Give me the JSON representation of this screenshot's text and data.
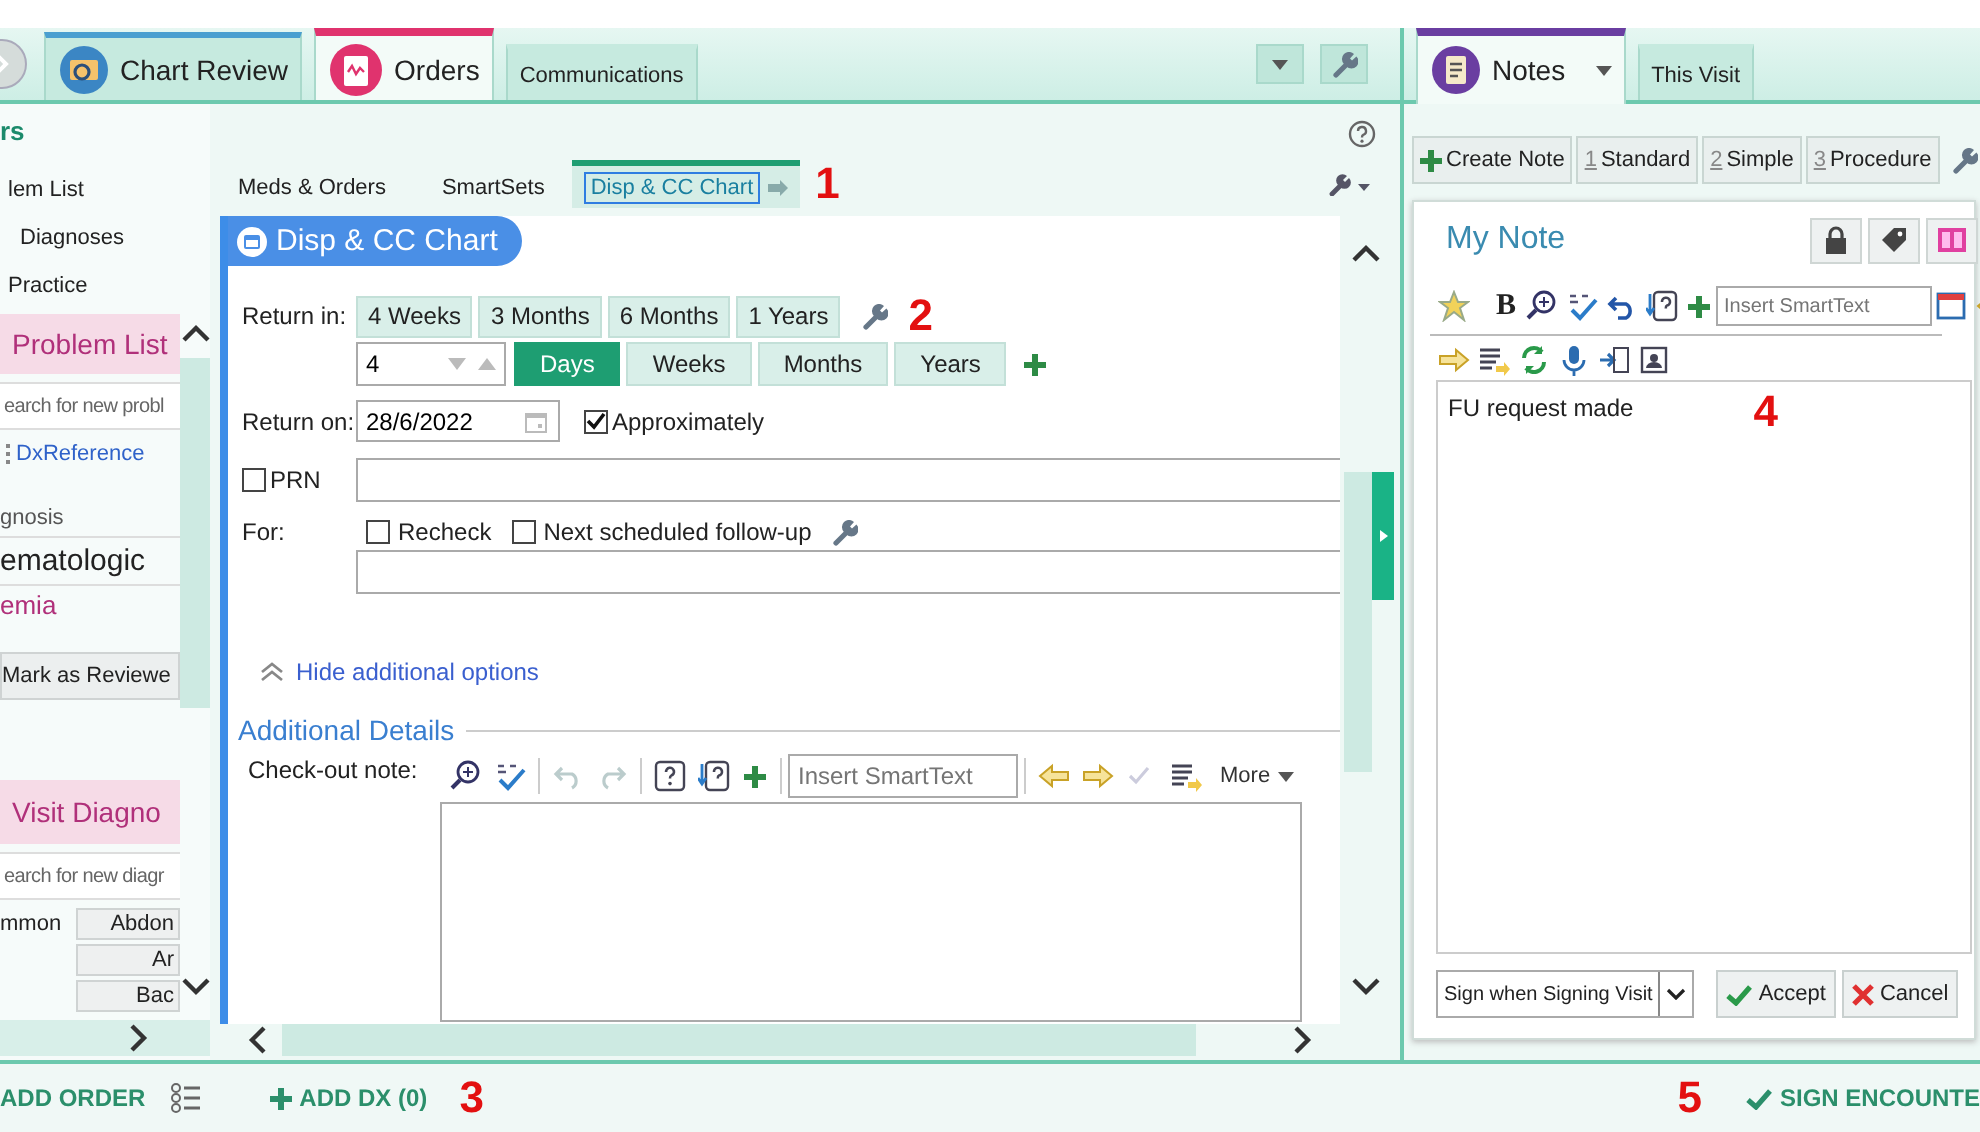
{
  "top_tabs": [
    {
      "label": "Chart Review",
      "selected": false,
      "color": "#4a9fd0"
    },
    {
      "label": "Orders",
      "selected": true,
      "color": "#e0336e"
    },
    {
      "label": "Communications",
      "selected": false
    }
  ],
  "notes_tabs": [
    {
      "label": "Notes",
      "selected": true,
      "color": "#6a3ea1"
    },
    {
      "label": "This Visit",
      "selected": false
    }
  ],
  "sidebar": {
    "header": "rs",
    "items": [
      {
        "label": "lem List"
      },
      {
        "label": "Diagnoses"
      },
      {
        "label": "Practice"
      }
    ],
    "problem_list": {
      "title": "Problem List",
      "search_placeholder": "earch for new probl",
      "link": "DxReference",
      "column_header": "gnosis",
      "group": "ematologic",
      "problem": "emia",
      "review_button": "Mark as Reviewe"
    },
    "visit_diagnoses": {
      "title": "Visit Diagno",
      "search_placeholder": "earch for new diagr",
      "label": "mmon",
      "buttons": [
        "Abdon",
        "Ar",
        "Bac"
      ]
    }
  },
  "activity_tabs": {
    "tabs": [
      {
        "label": "Meds & Orders",
        "selected": false
      },
      {
        "label": "SmartSets",
        "selected": false
      },
      {
        "label": "Disp & CC Chart",
        "selected": true
      }
    ],
    "annotation": "1"
  },
  "form": {
    "title": "Disp & CC Chart",
    "return_in": {
      "label": "Return in:",
      "presets": [
        "4 Weeks",
        "3 Months",
        "6 Months",
        "1 Years"
      ],
      "annotation": "2",
      "amount": "4",
      "units": [
        {
          "label": "Days",
          "selected": true
        },
        {
          "label": "Weeks",
          "selected": false
        },
        {
          "label": "Months",
          "selected": false
        },
        {
          "label": "Years",
          "selected": false
        }
      ]
    },
    "return_on": {
      "label": "Return on:",
      "value": "28/6/2022"
    },
    "approximately": {
      "label": "Approximately",
      "checked": true
    },
    "prn": {
      "label": "PRN",
      "checked": false
    },
    "for": {
      "label": "For:",
      "options": [
        {
          "label": "Recheck",
          "checked": false
        },
        {
          "label": "Next scheduled follow-up",
          "checked": false
        }
      ]
    },
    "hide_options": "Hide additional options",
    "additional_details": "Additional Details",
    "checkout_note": {
      "label": "Check-out note:",
      "smarttext_placeholder": "Insert SmartText",
      "more": "More"
    }
  },
  "notes": {
    "toolbar": [
      {
        "label": "Create Note"
      },
      {
        "number": "1",
        "label": "Standard"
      },
      {
        "number": "2",
        "label": "Simple"
      },
      {
        "number": "3",
        "label": "Procedure"
      }
    ],
    "title": "My Note",
    "bold_button": "B",
    "smarttext_placeholder": "Insert SmartText",
    "text": "FU request made",
    "annotation": "4",
    "sign_option": "Sign when Signing Visit",
    "accept": "Accept",
    "cancel": "Cancel"
  },
  "footer": {
    "add_order": "ADD ORDER",
    "add_dx": "ADD DX (0)",
    "annotations": [
      "3",
      "5"
    ],
    "sign": "SIGN ENCOUNTE"
  }
}
